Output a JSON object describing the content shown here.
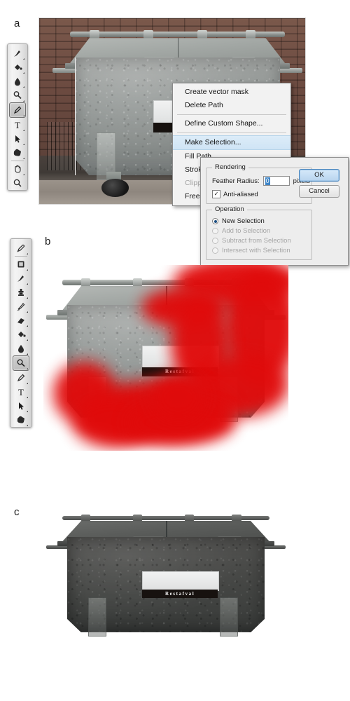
{
  "figure": {
    "panels": [
      {
        "id": "a",
        "label": "a"
      },
      {
        "id": "b",
        "label": "b"
      },
      {
        "id": "c",
        "label": "c"
      }
    ]
  },
  "photo": {
    "subject": "galvanized-waste-container",
    "label_plate_text": "Restafval",
    "label_plate_text_clipped": "Re"
  },
  "toolbar_a": {
    "name": "photoshop-tools-panel",
    "tools": [
      {
        "name": "brush-tool",
        "glyph": "brush",
        "selected": false
      },
      {
        "name": "paint-bucket-tool",
        "glyph": "bucket",
        "selected": false
      },
      {
        "name": "blur-tool",
        "glyph": "drop",
        "selected": false
      },
      {
        "name": "dodge-tool",
        "glyph": "dodge",
        "selected": false
      },
      {
        "name": "pen-tool",
        "glyph": "pen",
        "selected": true
      },
      {
        "name": "type-tool",
        "glyph": "T",
        "selected": false
      },
      {
        "name": "path-selection-tool",
        "glyph": "arrow",
        "selected": false
      },
      {
        "name": "custom-shape-tool",
        "glyph": "shape",
        "selected": false
      },
      {
        "name": "hand-tool",
        "glyph": "hand",
        "selected": false
      },
      {
        "name": "zoom-tool",
        "glyph": "magnifier",
        "selected": false
      }
    ]
  },
  "toolbar_b": {
    "name": "photoshop-tools-panel",
    "tools": [
      {
        "name": "eyedropper-tool",
        "glyph": "eyedropper",
        "selected": false
      },
      {
        "name": "spot-healing-brush-tool",
        "glyph": "patch",
        "selected": false
      },
      {
        "name": "brush-tool",
        "glyph": "brush",
        "selected": false
      },
      {
        "name": "clone-stamp-tool",
        "glyph": "stamp",
        "selected": false
      },
      {
        "name": "history-brush-tool",
        "glyph": "historybrush",
        "selected": false
      },
      {
        "name": "eraser-tool",
        "glyph": "eraser",
        "selected": false
      },
      {
        "name": "paint-bucket-tool",
        "glyph": "bucket",
        "selected": false
      },
      {
        "name": "blur-tool",
        "glyph": "drop",
        "selected": false
      },
      {
        "name": "dodge-tool",
        "glyph": "dodge",
        "selected": true
      },
      {
        "name": "pen-tool",
        "glyph": "pen",
        "selected": false
      },
      {
        "name": "type-tool",
        "glyph": "T",
        "selected": false
      },
      {
        "name": "path-selection-tool",
        "glyph": "arrow",
        "selected": false
      },
      {
        "name": "custom-shape-tool",
        "glyph": "shape",
        "selected": false
      }
    ]
  },
  "context_menu": {
    "items": [
      {
        "label": "Create vector mask",
        "state": "normal"
      },
      {
        "label": "Delete Path",
        "state": "normal"
      },
      {
        "label": "SEPARATOR",
        "state": "separator"
      },
      {
        "label": "Define Custom Shape...",
        "state": "normal"
      },
      {
        "label": "SEPARATOR",
        "state": "separator"
      },
      {
        "label": "Make Selection...",
        "state": "highlighted"
      },
      {
        "label": "Fill Path...",
        "state": "normal"
      },
      {
        "label": "Stroke Path...",
        "state": "normal"
      },
      {
        "label": "Clipping Path...",
        "state": "disabled"
      },
      {
        "label": "Free Transform Path",
        "state": "normal"
      }
    ]
  },
  "dialog": {
    "rendering_legend": "Rendering",
    "feather_label": "Feather Radius:",
    "feather_value": "0",
    "feather_units": "pixels",
    "anti_aliased_label": "Anti-aliased",
    "anti_aliased_checked": true,
    "check_glyph": "✓",
    "operation_legend": "Operation",
    "operations": [
      {
        "label": "New Selection",
        "selected": true,
        "disabled": false
      },
      {
        "label": "Add to Selection",
        "selected": false,
        "disabled": true
      },
      {
        "label": "Subtract from Selection",
        "selected": false,
        "disabled": true
      },
      {
        "label": "Intersect with Selection",
        "selected": false,
        "disabled": true
      }
    ],
    "ok_label": "OK",
    "cancel_label": "Cancel"
  },
  "colors": {
    "quickmask_red": "#e00b0b",
    "highlight_blue": "#cfe4f5",
    "default_button_blue": "#b7d4ee",
    "selection_blue": "#3d84c6"
  }
}
